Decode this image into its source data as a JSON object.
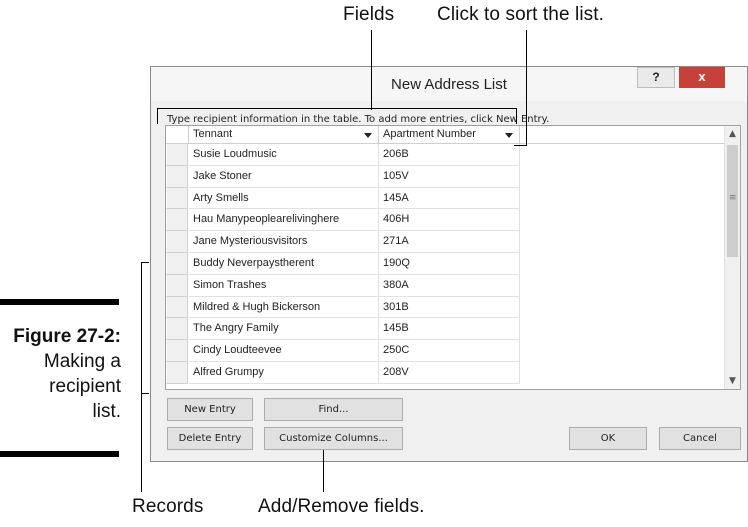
{
  "callouts": {
    "fields": "Fields",
    "sort": "Click to sort the list.",
    "records": "Records",
    "add_remove": "Add/Remove fields."
  },
  "figure": {
    "number": "Figure 27-2:",
    "caption_lines": [
      "Making a",
      "recipient",
      "list."
    ]
  },
  "window": {
    "title": "New Address List",
    "help_label": "?",
    "close_label": "x",
    "instruction": "Type recipient information in the table.  To add more entries, click New Entry."
  },
  "table": {
    "columns": [
      "Tennant",
      "Apartment Number"
    ],
    "rows": [
      [
        "Susie Loudmusic",
        "206B"
      ],
      [
        "Jake Stoner",
        "105V"
      ],
      [
        "Arty Smells",
        "145A"
      ],
      [
        "Hau Manypeoplearelivinghere",
        "406H"
      ],
      [
        "Jane Mysteriousvisitors",
        "271A"
      ],
      [
        "Buddy Neverpaystherent",
        "190Q"
      ],
      [
        "Simon Trashes",
        "380A"
      ],
      [
        "Mildred & Hugh Bickerson",
        "301B"
      ],
      [
        "The Angry Family",
        "145B"
      ],
      [
        "Cindy Loudteevee",
        "250C"
      ],
      [
        "Alfred Grumpy",
        "208V"
      ]
    ]
  },
  "buttons": {
    "new_entry": "New Entry",
    "find": "Find...",
    "delete_entry": "Delete Entry",
    "customize_columns": "Customize Columns...",
    "ok": "OK",
    "cancel": "Cancel"
  },
  "scrollbar": {
    "up_icon": "▲",
    "down_icon": "▼",
    "grip": "≡"
  }
}
